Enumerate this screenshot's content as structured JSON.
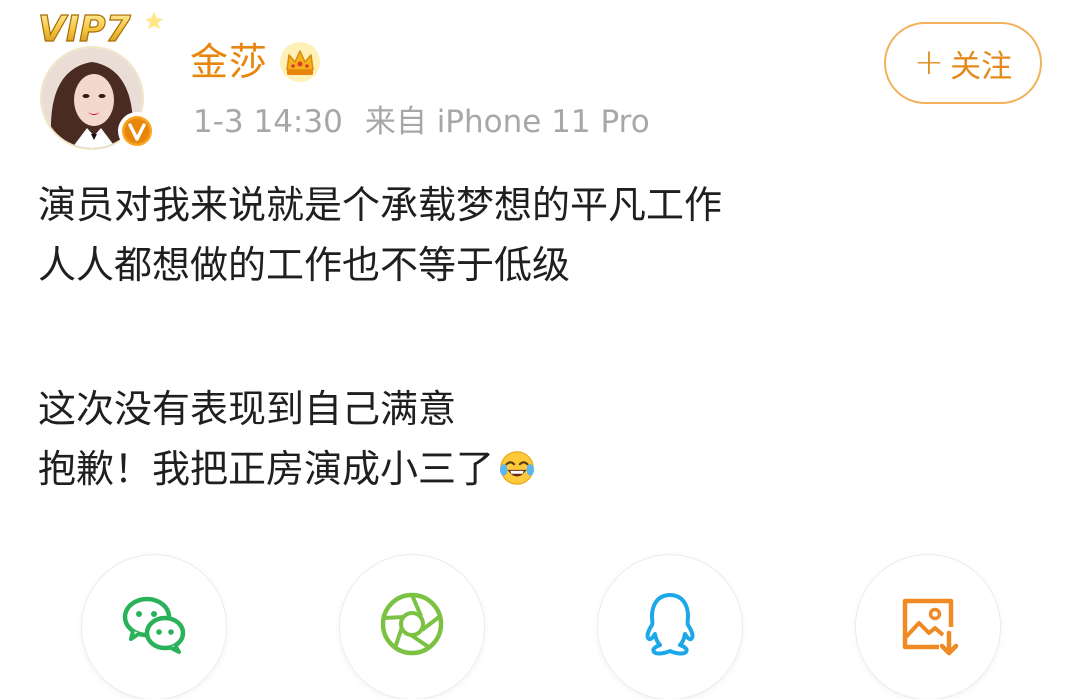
{
  "post": {
    "author": {
      "name": "金莎",
      "vip_level_label": "VIP7",
      "crown_icon": "crown-icon",
      "verified_icon": "verified-v-icon"
    },
    "timestamp": "1-3 14:30",
    "source_prefix": "来自",
    "source_device": "iPhone 11 Pro",
    "follow_button": {
      "plus": "+",
      "label": "关注"
    },
    "text_lines": [
      "演员对我来说就是个承载梦想的平凡工作",
      "人人都想做的工作也不等于低级",
      "",
      "这次没有表现到自己满意",
      "抱歉！我把正房演成小三了"
    ],
    "trailing_emoji": "laughing-tears-emoji"
  },
  "share": {
    "targets": [
      {
        "name": "wechat",
        "icon": "wechat-icon"
      },
      {
        "name": "moments",
        "icon": "moments-icon"
      },
      {
        "name": "qq",
        "icon": "qq-icon"
      },
      {
        "name": "save-image",
        "icon": "save-image-icon"
      }
    ]
  },
  "colors": {
    "accent_orange": "#e8860c",
    "follow_border": "#f2b25b",
    "meta_gray": "#a7a7a7",
    "wechat_green": "#2ab25b",
    "moments_green": "#7cc242",
    "qq_blue": "#1ca7e8",
    "save_orange": "#f08a24"
  }
}
